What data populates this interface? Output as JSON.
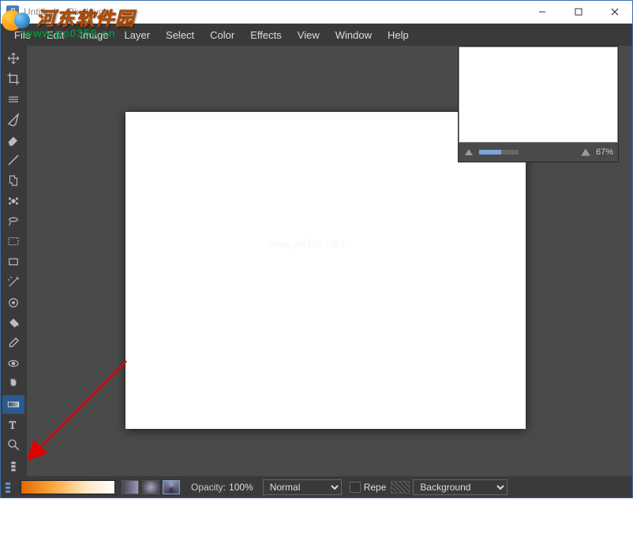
{
  "window": {
    "title": "Untitled* - Pixeluvo",
    "app_icon_letter": "P"
  },
  "menu": [
    "File",
    "Edit",
    "Image",
    "Layer",
    "Select",
    "Color",
    "Effects",
    "View",
    "Window",
    "Help"
  ],
  "tools": [
    {
      "name": "move-tool",
      "icon": "move"
    },
    {
      "name": "crop-tool",
      "icon": "crop"
    },
    {
      "name": "transform-tool",
      "icon": "transform"
    },
    {
      "name": "brush-tool",
      "icon": "brush"
    },
    {
      "name": "eraser-tool",
      "icon": "eraser"
    },
    {
      "name": "line-tool",
      "icon": "line"
    },
    {
      "name": "clone-tool",
      "icon": "clone"
    },
    {
      "name": "heal-tool",
      "icon": "heal"
    },
    {
      "name": "lasso-tool",
      "icon": "lasso"
    },
    {
      "name": "rect-select-tool",
      "icon": "rect"
    },
    {
      "name": "shape-tool",
      "icon": "shape"
    },
    {
      "name": "wand-tool",
      "icon": "wand"
    },
    {
      "name": "color-select-tool",
      "icon": "colorsel"
    },
    {
      "name": "bucket-tool",
      "icon": "bucket"
    },
    {
      "name": "eyedropper-tool",
      "icon": "eyedrop"
    },
    {
      "name": "redeye-tool",
      "icon": "redeye"
    },
    {
      "name": "smudge-tool",
      "icon": "hand"
    },
    {
      "name": "gradient-tool",
      "icon": "gradient",
      "selected": true
    },
    {
      "name": "text-tool",
      "icon": "text"
    },
    {
      "name": "zoom-tool",
      "icon": "zoom"
    }
  ],
  "navigator": {
    "zoom_percent": "67%"
  },
  "options": {
    "opacity_label": "Opacity:",
    "opacity_value": "100%",
    "blend_mode": "Normal",
    "repeat_label": "Repe",
    "layer_label": "Background"
  },
  "watermark": {
    "site_text": "河东软件园",
    "url_text": "www.pc0359.cn",
    "center_text": "www.yxl365.NET"
  }
}
